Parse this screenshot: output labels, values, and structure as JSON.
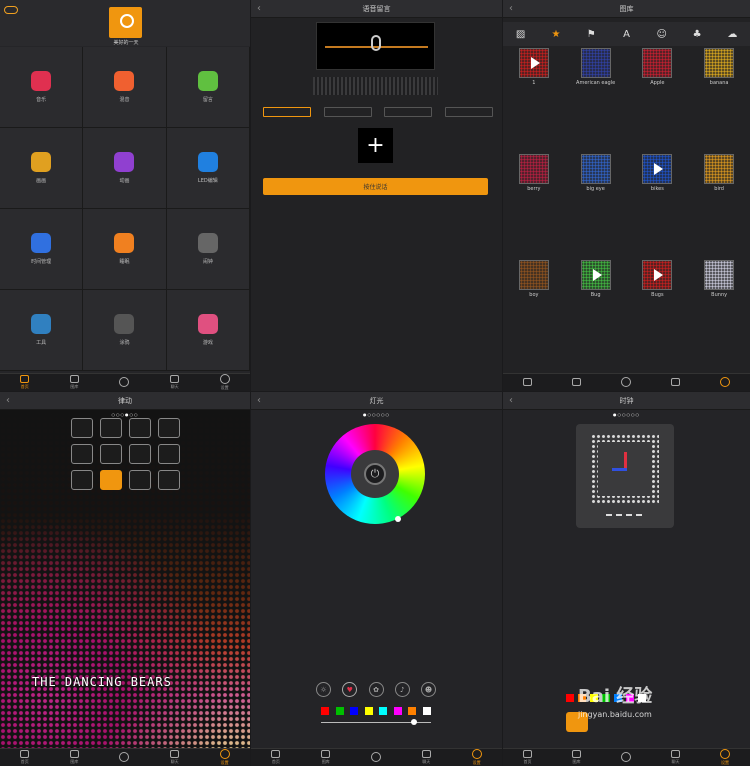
{
  "home": {
    "username": "美好的一天",
    "apps": [
      {
        "label": "音乐",
        "color": "#e03050"
      },
      {
        "label": "混音",
        "color": "#f06030"
      },
      {
        "label": "留言",
        "color": "#60c040"
      },
      {
        "label": "画画",
        "color": "#e0a020"
      },
      {
        "label": "动画",
        "color": "#9040d0"
      },
      {
        "label": "LED编辑",
        "color": "#2080e0"
      },
      {
        "label": "时间管理",
        "color": "#3070e0"
      },
      {
        "label": "睡眠",
        "color": "#f08020"
      },
      {
        "label": "闹钟",
        "color": "#666666"
      },
      {
        "label": "工具",
        "color": "#3080c0"
      },
      {
        "label": "涂鸦",
        "color": "#555555"
      },
      {
        "label": "游戏",
        "color": "#e05080"
      }
    ]
  },
  "nav": {
    "items": [
      "首页",
      "图库",
      "",
      "聊天",
      "设置"
    ]
  },
  "voice": {
    "title": "语音留言",
    "talk_label": "按住说话"
  },
  "gallery": {
    "title": "图库",
    "cats": [
      "▨",
      "★",
      "⚑",
      "A",
      "☺",
      "♣",
      "☁"
    ],
    "items": [
      {
        "label": "1",
        "color": "#c02020"
      },
      {
        "label": "American eagle",
        "color": "#3040a0"
      },
      {
        "label": "Apple",
        "color": "#c02030"
      },
      {
        "label": "banana",
        "color": "#d0a020"
      },
      {
        "label": "berry",
        "color": "#b02040"
      },
      {
        "label": "big eye",
        "color": "#3060c0"
      },
      {
        "label": "bikes",
        "color": "#2050c0"
      },
      {
        "label": "bird",
        "color": "#d09020"
      },
      {
        "label": "boy",
        "color": "#8a5020"
      },
      {
        "label": "Bug",
        "color": "#40b040"
      },
      {
        "label": "Bugs",
        "color": "#c02020"
      },
      {
        "label": "Bunny",
        "color": "#c0c0d0"
      }
    ]
  },
  "rhythm": {
    "title": "律动",
    "banner": "THE DANCING BEARS",
    "pager": "○○○●○○"
  },
  "light": {
    "title": "灯光",
    "pager": "●○○○○○",
    "modes": [
      "☼",
      "♥",
      "✿",
      "♪",
      "☻"
    ],
    "swatches": [
      "#ff0000",
      "#00c000",
      "#0000ff",
      "#ffff00",
      "#00ffff",
      "#ff00ff",
      "#ff8000",
      "#ffffff"
    ]
  },
  "clock": {
    "title": "时钟",
    "pager": "●○○○○○",
    "swatches": [
      "#ff0000",
      "#ff8000",
      "#ffff00",
      "#00c000",
      "#0080ff",
      "#ff00ff",
      "#ffffff"
    ]
  },
  "watermark": {
    "brand": "Bai 经验",
    "url": "jingyan.baidu.com"
  }
}
